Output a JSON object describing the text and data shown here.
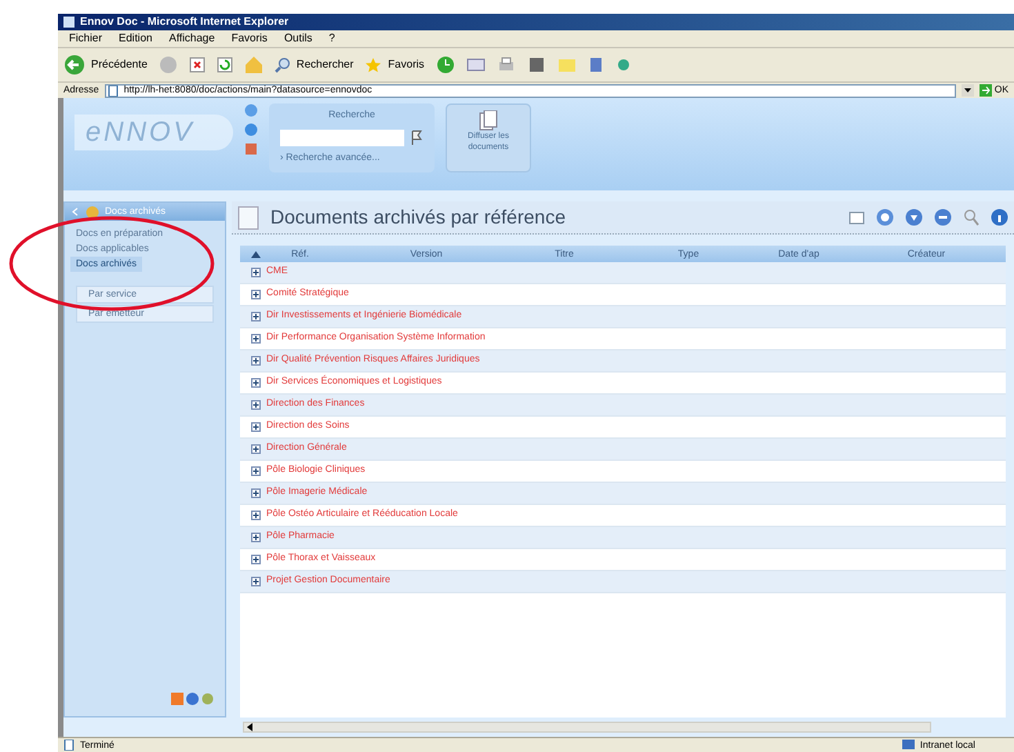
{
  "window": {
    "title": "Ennov Doc - Microsoft Internet Explorer"
  },
  "menu": [
    "Fichier",
    "Edition",
    "Affichage",
    "Favoris",
    "Outils",
    "?"
  ],
  "toolbar": {
    "back": "Précédente",
    "search": "Rechercher",
    "favorites": "Favoris"
  },
  "address_bar": {
    "label": "Adresse",
    "url": "http://lh-het:8080/doc/actions/main?datasource=ennovdoc",
    "go": "OK"
  },
  "header": {
    "logo": "eNNOV",
    "search": {
      "title": "Recherche",
      "advanced": "› Recherche avancée..."
    },
    "action_button": [
      "Diffuser les",
      "documents"
    ]
  },
  "sidebar": {
    "title": "Docs archivés",
    "items": [
      {
        "label": "Docs en préparation",
        "selected": false
      },
      {
        "label": "Docs applicables",
        "selected": false
      },
      {
        "label": "Docs archivés",
        "selected": true
      }
    ],
    "subitems": [
      "Par service",
      "Par émetteur"
    ]
  },
  "panel": {
    "title": "Documents archivés par référence"
  },
  "table": {
    "columns": [
      "Réf.",
      "Version",
      "Titre",
      "Type",
      "Date d'ap",
      "Créateur"
    ],
    "rows": [
      {
        "label": "CME",
        "expanded": false
      },
      {
        "label": "Comité Stratégique",
        "expanded": false
      },
      {
        "label": "Dir Investissements et Ingénierie Biomédicale",
        "expanded": false
      },
      {
        "label": "Dir Performance Organisation Système Information",
        "expanded": false
      },
      {
        "label": "Dir Qualité Prévention Risques Affaires Juridiques",
        "expanded": false
      },
      {
        "label": "Dir Services Économiques et Logistiques",
        "expanded": false
      },
      {
        "label": "Direction des Finances",
        "expanded": false
      },
      {
        "label": "Direction des Soins",
        "expanded": false
      },
      {
        "label": "Direction Générale",
        "expanded": false
      },
      {
        "label": "Pôle Biologie Cliniques",
        "expanded": false
      },
      {
        "label": "Pôle Imagerie Médicale",
        "expanded": false
      },
      {
        "label": "Pôle Ostéo Articulaire et Rééducation Locale",
        "expanded": false
      },
      {
        "label": "Pôle Pharmacie",
        "expanded": false
      },
      {
        "label": "Pôle Thorax et Vaisseaux",
        "expanded": false
      },
      {
        "label": "Projet Gestion Documentaire",
        "expanded": false
      }
    ]
  },
  "status_bar": {
    "text": "Terminé",
    "zone": "Intranet local"
  }
}
